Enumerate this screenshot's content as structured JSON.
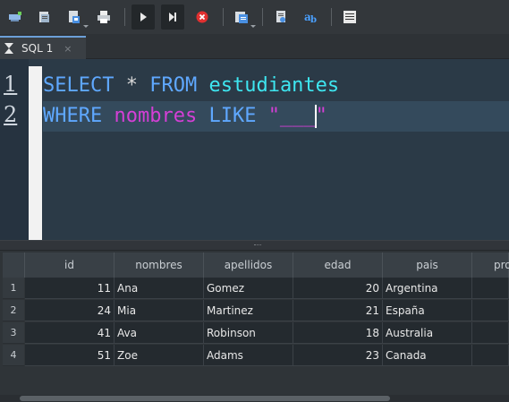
{
  "toolbar": {
    "buttons": [
      {
        "name": "new-connection-icon",
        "color": "#8fb8e8"
      },
      {
        "name": "open-file-icon",
        "color": "#d8dde2"
      },
      {
        "name": "save-file-icon",
        "color": "#d8dde2"
      },
      {
        "name": "print-icon",
        "color": "#d8dde2"
      },
      {
        "name": "run-icon",
        "color": "#e8e8e8"
      },
      {
        "name": "run-step-icon",
        "color": "#e8e8e8"
      },
      {
        "name": "stop-icon",
        "color": "#e03030"
      },
      {
        "name": "results-icon",
        "color": "#d8dde2"
      },
      {
        "name": "explain-icon",
        "color": "#d8dde2"
      },
      {
        "name": "format-icon",
        "color": "#4aa0ff"
      },
      {
        "name": "output-icon",
        "color": "#e8e8e8"
      }
    ]
  },
  "tab": {
    "label": "SQL 1",
    "close": "×"
  },
  "editor": {
    "line_numbers": [
      "1",
      "2"
    ],
    "line1": {
      "kw1": "SELECT",
      "op": " * ",
      "kw2": "FROM",
      "sp": " ",
      "table": "estudiantes"
    },
    "line2": {
      "kw1": "WHERE",
      "sp1": " ",
      "column": "nombres",
      "sp2": " ",
      "kw2": "LIKE",
      "sp3": " ",
      "str_open": "\"___",
      "str_close": "\""
    }
  },
  "grid": {
    "columns": [
      "id",
      "nombres",
      "apellidos",
      "edad",
      "pais",
      "pro"
    ],
    "rows": [
      {
        "n": "1",
        "id": "11",
        "nombres": "Ana",
        "apellidos": "Gomez",
        "edad": "20",
        "pais": "Argentina"
      },
      {
        "n": "2",
        "id": "24",
        "nombres": "Mia",
        "apellidos": "Martinez",
        "edad": "21",
        "pais": "España"
      },
      {
        "n": "3",
        "id": "41",
        "nombres": "Ava",
        "apellidos": "Robinson",
        "edad": "18",
        "pais": "Australia"
      },
      {
        "n": "4",
        "id": "51",
        "nombres": "Zoe",
        "apellidos": "Adams",
        "edad": "23",
        "pais": "Canada"
      }
    ]
  },
  "colors": {
    "keyword": "#5fa8ff",
    "table": "#3ee6f0",
    "column": "#d43fd6",
    "string": "#d43fd6",
    "tab_accent": "#6c9fd8"
  }
}
